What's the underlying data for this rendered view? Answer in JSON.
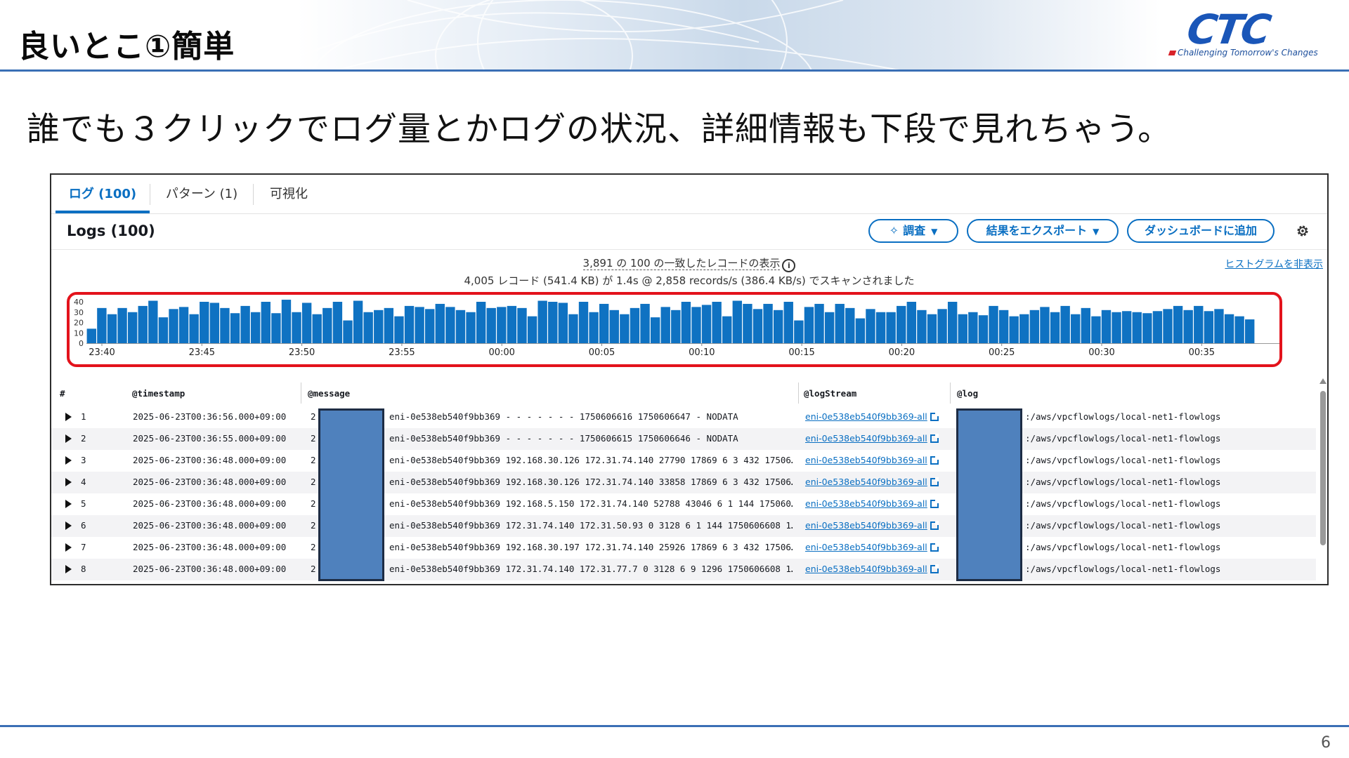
{
  "slide": {
    "title": "良いとこ①簡単",
    "subtitle": "誰でも３クリックでログ量とかログの状況、詳細情報も下段で見れちゃう。",
    "page_number": "6"
  },
  "logo": {
    "mark": "CTC",
    "tagline": "Challenging Tomorrow's Changes"
  },
  "tabs": [
    {
      "label": "ログ (100)",
      "active": true
    },
    {
      "label": "パターン (1)",
      "active": false
    },
    {
      "label": "可視化",
      "active": false
    }
  ],
  "logs_header": {
    "title": "Logs (100)",
    "investigate_label": "調査",
    "export_label": "結果をエクスポート",
    "dashboard_label": "ダッシュボードに追加"
  },
  "summary": {
    "matched": "3,891 の 100 の一致したレコードの表示",
    "scanned": "4,005 レコード (541.4 KB) が 1.4s @ 2,858 records/s (386.4 KB/s) でスキャンされました",
    "hide_histogram": "ヒストグラムを非表示"
  },
  "chart_data": {
    "type": "bar",
    "y_ticks": [
      "40",
      "30",
      "20",
      "10",
      "0"
    ],
    "ylim": [
      0,
      40
    ],
    "x_ticks": [
      "23:40",
      "23:45",
      "23:50",
      "23:55",
      "00:00",
      "00:05",
      "00:10",
      "00:15",
      "00:20",
      "00:25",
      "00:30",
      "00:35"
    ],
    "color": "#0f72c2",
    "values": [
      14,
      34,
      28,
      34,
      30,
      36,
      41,
      25,
      33,
      35,
      28,
      40,
      39,
      34,
      29,
      36,
      30,
      40,
      29,
      42,
      30,
      39,
      28,
      34,
      40,
      22,
      41,
      30,
      32,
      34,
      26,
      36,
      35,
      33,
      38,
      35,
      32,
      30,
      40,
      34,
      35,
      36,
      34,
      26,
      41,
      40,
      39,
      28,
      40,
      30,
      38,
      32,
      28,
      34,
      38,
      25,
      35,
      32,
      40,
      35,
      37,
      40,
      26,
      41,
      38,
      33,
      38,
      32,
      40,
      22,
      35,
      38,
      30,
      38,
      34,
      24,
      33,
      30,
      30,
      36,
      40,
      32,
      28,
      33,
      40,
      28,
      30,
      27,
      36,
      32,
      26,
      28,
      32,
      35,
      30,
      36,
      28,
      34,
      26,
      32,
      30,
      31,
      30,
      29,
      31,
      33,
      36,
      32,
      36,
      31,
      33,
      28,
      26,
      23
    ]
  },
  "table": {
    "columns": [
      "#",
      "@timestamp",
      "@message",
      "@logStream",
      "@log"
    ],
    "rows": [
      {
        "n": "1",
        "timestamp": "2025-06-23T00:36:56.000+09:00",
        "msg_prefix": "2",
        "message": "eni-0e538eb540f9bb369 - - - - - - - 1750606616 1750606647 - NODATA",
        "stream": "eni-0e538eb540f9bb369-all",
        "log": ":/aws/vpcflowlogs/local-net1-flowlogs"
      },
      {
        "n": "2",
        "timestamp": "2025-06-23T00:36:55.000+09:00",
        "msg_prefix": "2",
        "message": "eni-0e538eb540f9bb369 - - - - - - - 1750606615 1750606646 - NODATA",
        "stream": "eni-0e538eb540f9bb369-all",
        "log": ":/aws/vpcflowlogs/local-net1-flowlogs"
      },
      {
        "n": "3",
        "timestamp": "2025-06-23T00:36:48.000+09:00",
        "msg_prefix": "2",
        "message": "eni-0e538eb540f9bb369 192.168.30.126 172.31.74.140 27790 17869 6 3 432 17506…",
        "stream": "eni-0e538eb540f9bb369-all",
        "log": ":/aws/vpcflowlogs/local-net1-flowlogs"
      },
      {
        "n": "4",
        "timestamp": "2025-06-23T00:36:48.000+09:00",
        "msg_prefix": "2",
        "message": "eni-0e538eb540f9bb369 192.168.30.126 172.31.74.140 33858 17869 6 3 432 17506…",
        "stream": "eni-0e538eb540f9bb369-all",
        "log": ":/aws/vpcflowlogs/local-net1-flowlogs"
      },
      {
        "n": "5",
        "timestamp": "2025-06-23T00:36:48.000+09:00",
        "msg_prefix": "2",
        "message": "eni-0e538eb540f9bb369 192.168.5.150 172.31.74.140 52788 43046 6 1 144 175060…",
        "stream": "eni-0e538eb540f9bb369-all",
        "log": ":/aws/vpcflowlogs/local-net1-flowlogs"
      },
      {
        "n": "6",
        "timestamp": "2025-06-23T00:36:48.000+09:00",
        "msg_prefix": "2",
        "message": "eni-0e538eb540f9bb369 172.31.74.140 172.31.50.93 0 3128 6 1 144 1750606608 1…",
        "stream": "eni-0e538eb540f9bb369-all",
        "log": ":/aws/vpcflowlogs/local-net1-flowlogs"
      },
      {
        "n": "7",
        "timestamp": "2025-06-23T00:36:48.000+09:00",
        "msg_prefix": "2",
        "message": "eni-0e538eb540f9bb369 192.168.30.197 172.31.74.140 25926 17869 6 3 432 17506…",
        "stream": "eni-0e538eb540f9bb369-all",
        "log": ":/aws/vpcflowlogs/local-net1-flowlogs"
      },
      {
        "n": "8",
        "timestamp": "2025-06-23T00:36:48.000+09:00",
        "msg_prefix": "2",
        "message": "eni-0e538eb540f9bb369 172.31.74.140 172.31.77.7 0 3128 6 9 1296 1750606608 1…",
        "stream": "eni-0e538eb540f9bb369-all",
        "log": ":/aws/vpcflowlogs/local-net1-flowlogs"
      }
    ]
  }
}
